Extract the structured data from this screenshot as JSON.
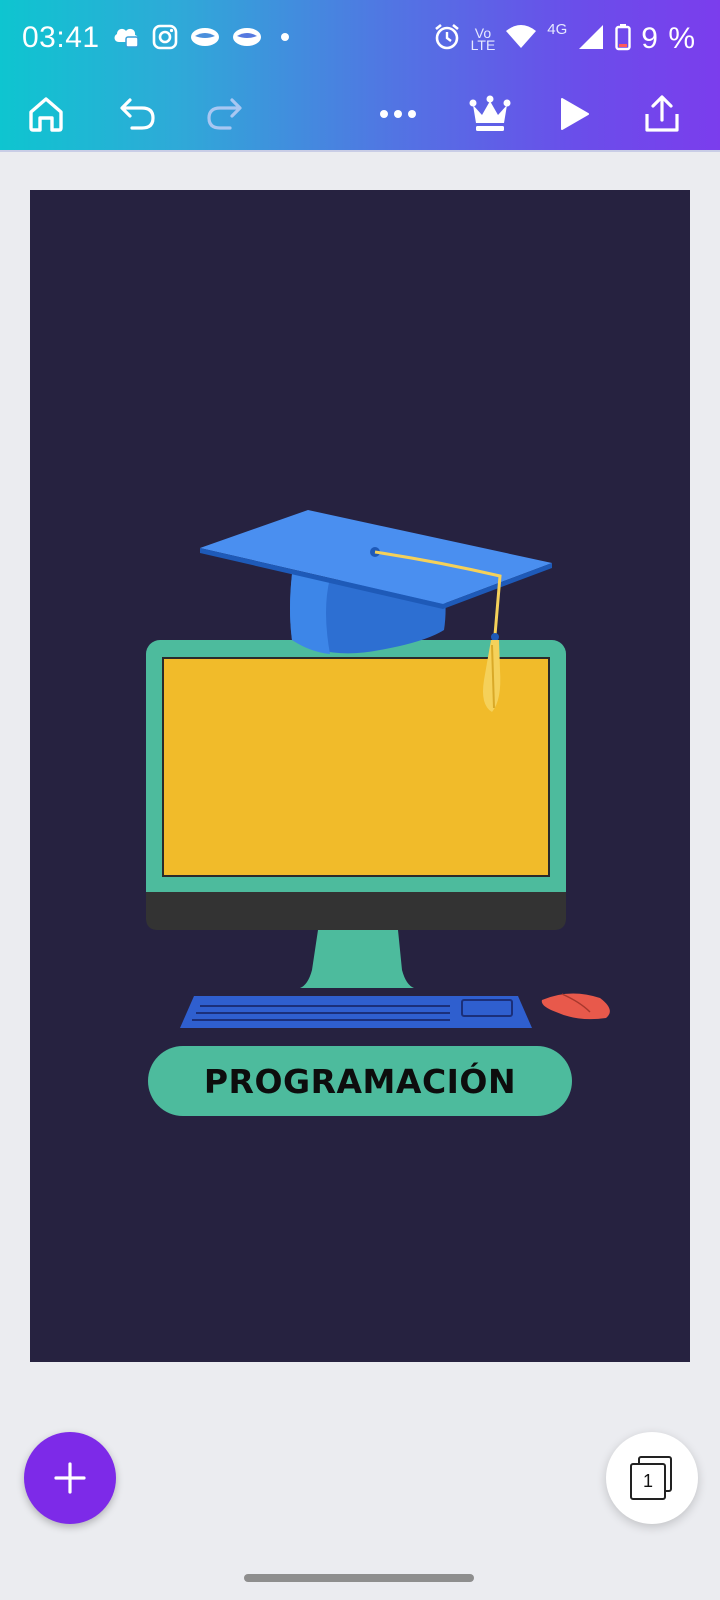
{
  "status_bar": {
    "time": "03:41",
    "notification_icons": [
      "cloud-chat-icon",
      "instagram-icon",
      "mask-icon",
      "mask-icon",
      "dot-icon"
    ],
    "network_label_top": "Vo",
    "network_label_bottom": "LTE",
    "network_type": "4G",
    "battery_text": "9 %"
  },
  "toolbar": {
    "icons": [
      "home-icon",
      "undo-icon",
      "redo-icon",
      "more-icon",
      "crown-icon",
      "play-icon",
      "share-icon"
    ]
  },
  "design": {
    "title": "PROGRAMACIÓN",
    "colors": {
      "background": "#262240",
      "monitor_frame": "#4dbb9d",
      "monitor_screen": "#f1bb2a",
      "monitor_base": "#333333",
      "keyboard": "#2f5fcf",
      "mouse": "#e8594b",
      "cap": "#3a7fe0",
      "tassel": "#f5d15a"
    }
  },
  "bottom": {
    "pages_count": "1"
  },
  "theme": {
    "header_gradient_start": "#0ec5d0",
    "header_gradient_end": "#7b3ded",
    "fab_color": "#7d2ae8"
  }
}
